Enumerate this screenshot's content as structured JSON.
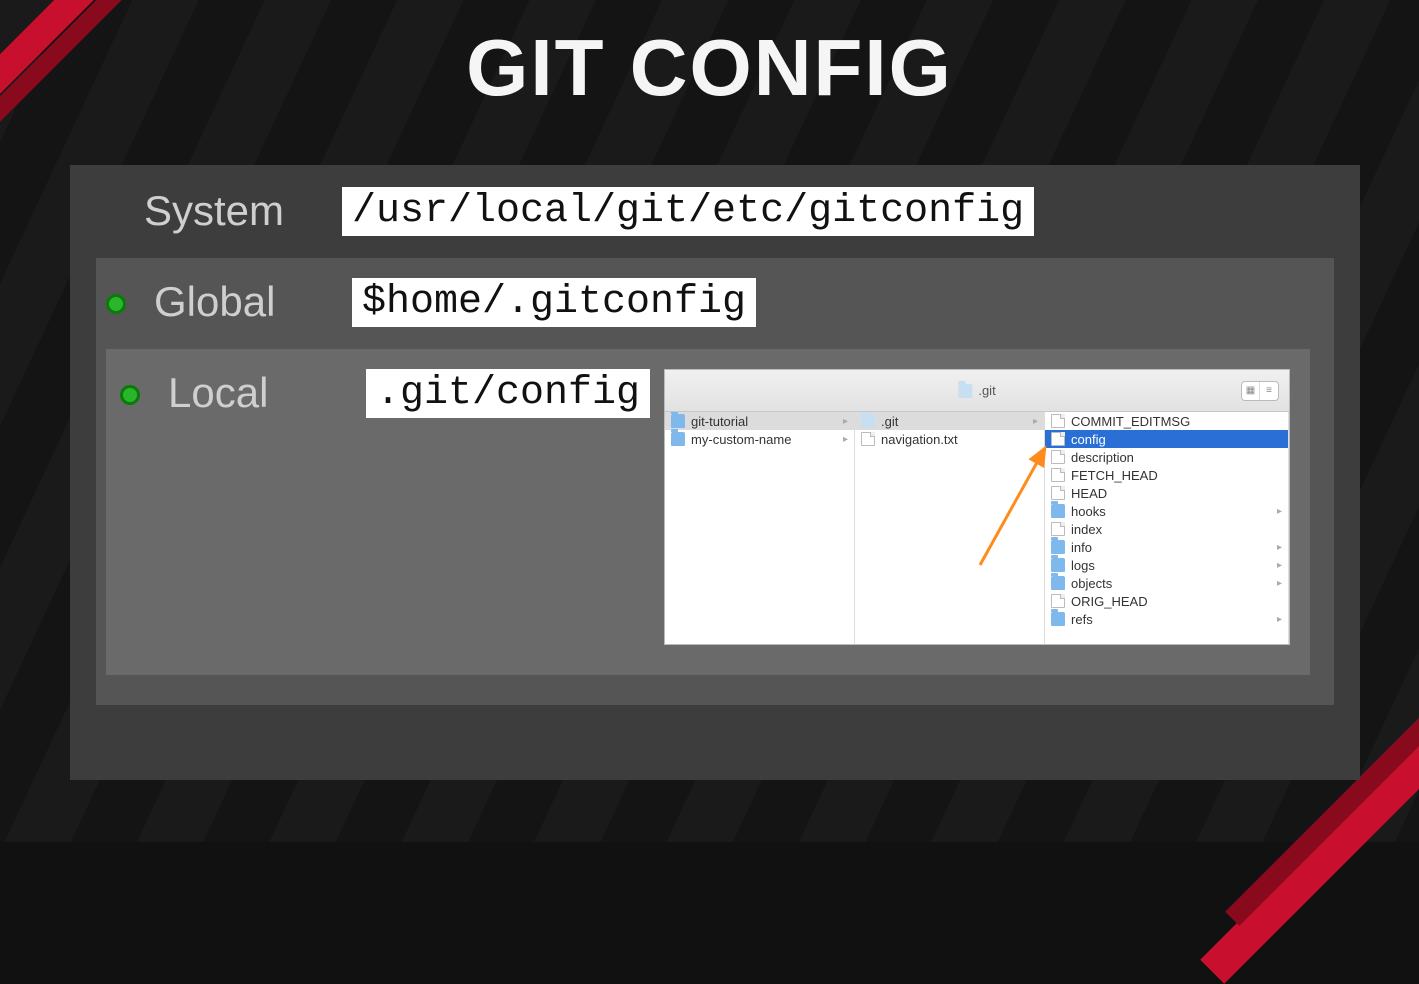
{
  "title": "GIT CONFIG",
  "levels": {
    "system": {
      "label": "System",
      "path": "/usr/local/git/etc/gitconfig",
      "bullet": false
    },
    "global": {
      "label": "Global",
      "path": "$home/.gitconfig",
      "bullet": true
    },
    "local": {
      "label": "Local",
      "path": ".git/config",
      "bullet": true
    }
  },
  "finder": {
    "title": ".git",
    "col1": [
      {
        "name": "git-tutorial",
        "type": "folder",
        "selected": true,
        "chevron": true
      },
      {
        "name": "my-custom-name",
        "type": "folder",
        "selected": false,
        "chevron": true
      }
    ],
    "col2": [
      {
        "name": ".git",
        "type": "folder-dim",
        "selected": true,
        "chevron": true
      },
      {
        "name": "navigation.txt",
        "type": "file",
        "selected": false,
        "chevron": false
      }
    ],
    "col3": [
      {
        "name": "COMMIT_EDITMSG",
        "type": "file",
        "selected": false,
        "chevron": false
      },
      {
        "name": "config",
        "type": "file",
        "selected": true,
        "chevron": false
      },
      {
        "name": "description",
        "type": "file",
        "selected": false,
        "chevron": false
      },
      {
        "name": "FETCH_HEAD",
        "type": "file",
        "selected": false,
        "chevron": false
      },
      {
        "name": "HEAD",
        "type": "file",
        "selected": false,
        "chevron": false
      },
      {
        "name": "hooks",
        "type": "folder",
        "selected": false,
        "chevron": true
      },
      {
        "name": "index",
        "type": "file",
        "selected": false,
        "chevron": false
      },
      {
        "name": "info",
        "type": "folder",
        "selected": false,
        "chevron": true
      },
      {
        "name": "logs",
        "type": "folder",
        "selected": false,
        "chevron": true
      },
      {
        "name": "objects",
        "type": "folder",
        "selected": false,
        "chevron": true
      },
      {
        "name": "ORIG_HEAD",
        "type": "file",
        "selected": false,
        "chevron": false
      },
      {
        "name": "refs",
        "type": "folder",
        "selected": false,
        "chevron": true
      }
    ]
  }
}
